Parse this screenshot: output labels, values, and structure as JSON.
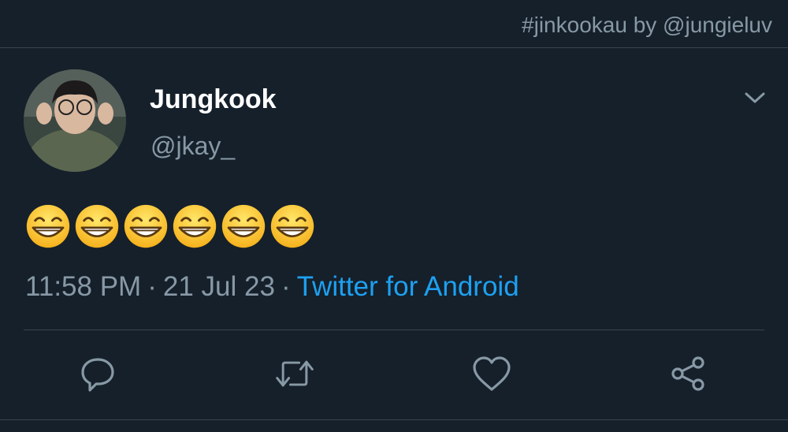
{
  "header": {
    "watermark": "#jinkookau by @jungieluv"
  },
  "tweet": {
    "author_name": "Jungkook",
    "author_handle": "@jkay_",
    "emoji_count": 6,
    "emoji_name": "grinning-face-with-smiling-eyes",
    "time": "11:58 PM",
    "date": "21 Jul 23",
    "source": "Twitter for Android",
    "separator": "·"
  },
  "actions": {
    "reply_icon": "reply-icon",
    "retweet_icon": "retweet-icon",
    "like_icon": "like-icon",
    "share_icon": "share-icon"
  },
  "colors": {
    "background": "#15202b",
    "muted_text": "#8899a6",
    "link": "#1da1f2",
    "border": "#38444d"
  }
}
